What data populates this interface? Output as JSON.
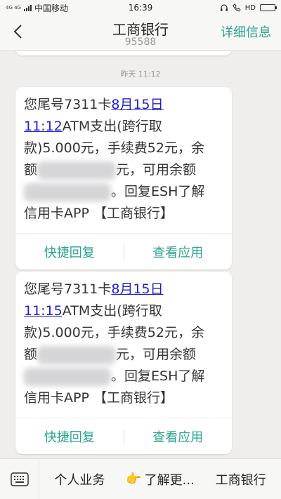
{
  "status_bar": {
    "network_tag": "4G 4G",
    "carrier": "中国移动",
    "time": "16:39",
    "hd_tag": "HD",
    "battery_level": 0.8
  },
  "header": {
    "title": "工商银行",
    "subtitle": "95588",
    "details_label": "详细信息"
  },
  "conversation": {
    "timestamp": "昨天 11:12",
    "messages": [
      {
        "prefix": "您尾号7311卡",
        "date_link": "8月15日",
        "time_link": "11:12",
        "line_a": "ATM支出(跨行取",
        "line_b": "款)5.000元，手续费52元，余",
        "line_c_start": "额",
        "line_c_end": "元，可用余额",
        "line_d_end": "。回复ESH了解",
        "line_e": "信用卡APP 【工商银行】",
        "quick_reply": "快捷回复",
        "view_app": "查看应用"
      },
      {
        "prefix": "您尾号7311卡",
        "date_link": "8月15日",
        "time_link": "11:15",
        "line_a": "ATM支出(跨行取",
        "line_b": "款)5.000元，手续费52元，余",
        "line_c_start": "额",
        "line_c_end": "元，可用余额",
        "line_d_end": "。回复ESH了解",
        "line_e": "信用卡APP 【工商银行】",
        "quick_reply": "快捷回复",
        "view_app": "查看应用"
      }
    ]
  },
  "bottom_menu": {
    "items": [
      "个人业务",
      "了解更...",
      "工商银行"
    ],
    "pointer_glyph": "👉"
  },
  "colors": {
    "accent": "#2aa28f",
    "link": "#1f1fd0",
    "background": "#efeeec"
  }
}
